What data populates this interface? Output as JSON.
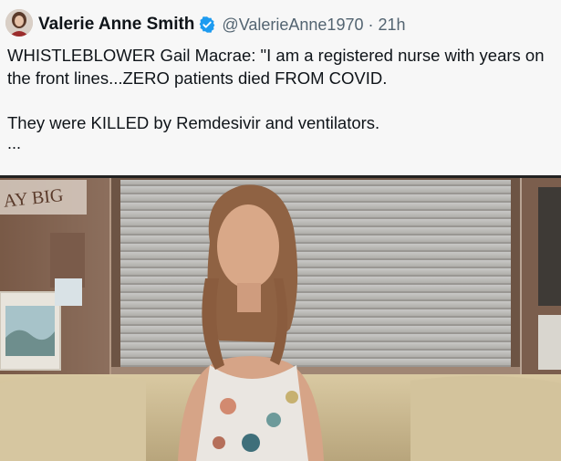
{
  "tweet": {
    "display_name": "Valerie Anne Smith",
    "handle": "@ValerieAnne1970",
    "separator": "·",
    "time": "21h",
    "verified": true,
    "verified_color": "#1d9bf0",
    "text_line1": "WHISTLEBLOWER Gail Macrae: \"I am a registered nurse with years on the front lines...ZERO patients died FROM COVID.",
    "text_line2": "They were KILLED by Remdesivir and ventilators.",
    "more": "..."
  },
  "media": {
    "kind": "video-still",
    "sign_text": "AY BIG"
  }
}
